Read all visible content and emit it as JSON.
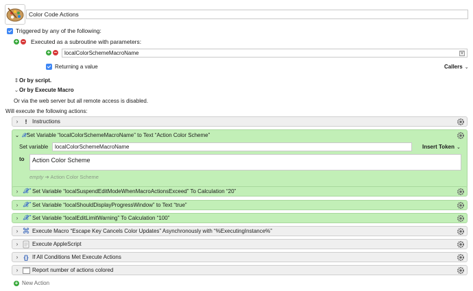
{
  "macro": {
    "name": "Color Code Actions",
    "icon": "palette-icon"
  },
  "trigger": {
    "triggered_label": "Triggered by any of the following:",
    "subroutine_label": "Executed as a subroutine with parameters:",
    "parameter_name": "localColorSchemeMacroName",
    "parameter_badge": "V",
    "returning_label": "Returning a value",
    "callers_label": "Callers",
    "or_by_script": "Or by script.",
    "or_by_execute_macro": "Or by Execute Macro",
    "web_server_note": "Or via the web server but all remote access is disabled."
  },
  "actions_header": "Will execute the following actions:",
  "actions": [
    {
      "label": "Instructions",
      "icon": "exclamation-icon"
    },
    {
      "label": "Set Variable “localColorSchemeMacroName” to Text “Action Color Scheme”",
      "icon": "variable-x-icon"
    },
    {
      "label": "Set Variable “localSuspendEditModeWhenMacroActionsExceed” To Calculation “20”",
      "icon": "variable-x-icon"
    },
    {
      "label": "Set Variable “localShouldDisplayProgressWindow” to Text “true”",
      "icon": "variable-x-icon"
    },
    {
      "label": "Set Variable “localEditLimitWarning” To Calculation “100”",
      "icon": "variable-x-icon"
    },
    {
      "label": "Execute Macro “Escape Key Cancels Color Updates” Asynchronously with “%ExecutingInstance%”",
      "icon": "command-key-icon"
    },
    {
      "label": "Execute AppleScript",
      "icon": "applescript-icon"
    },
    {
      "label": "If All Conditions Met Execute Actions",
      "icon": "braces-icon"
    },
    {
      "label": "Report number of actions colored",
      "icon": "window-icon"
    }
  ],
  "expanded": {
    "set_variable_label": "Set variable",
    "variable_name": "localColorSchemeMacroName",
    "insert_token_label": "Insert Token",
    "to_label": "to",
    "text_value": "Action Color Scheme",
    "preview_empty": "empty",
    "preview_value": "Action Color Scheme"
  },
  "new_action_label": "New Action",
  "colors": {
    "green_action": "#c2efb7",
    "gray_action": "#efefef",
    "accent_blue": "#3d86f5",
    "plus_green": "#39a93c",
    "minus_red": "#d73a3a"
  }
}
